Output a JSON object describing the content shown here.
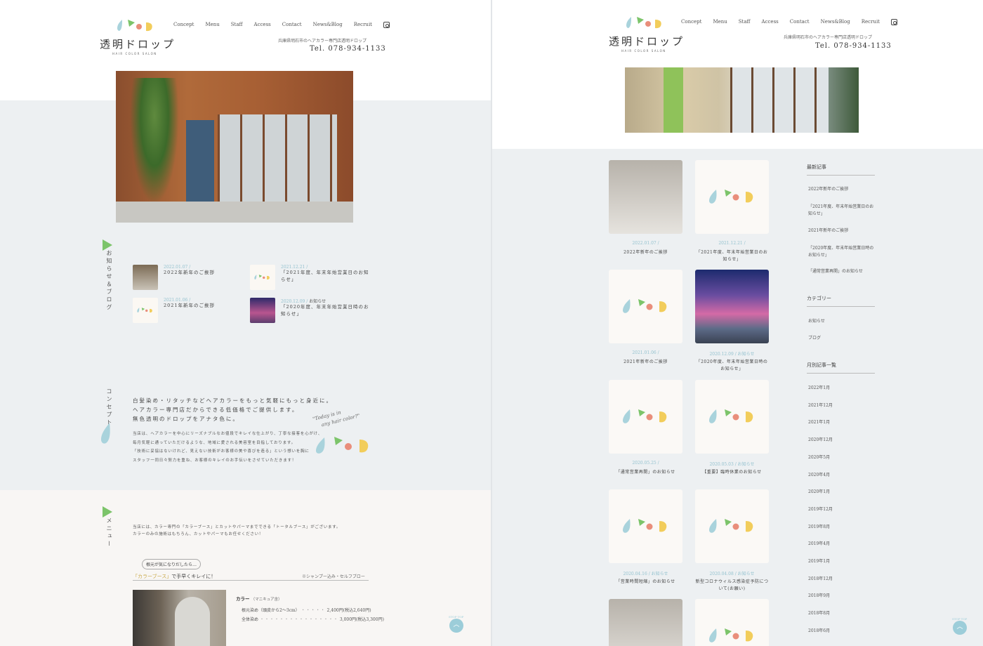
{
  "brand": {
    "name_jp": "透明ドロップ",
    "name_en": "HAIR COLOR SALON",
    "address": "兵庫県明石市のヘアカラー専門店透明ドロップ",
    "tel": "Tel. 078-934-1133"
  },
  "nav": [
    "Concept",
    "Menu",
    "Staff",
    "Access",
    "Contact",
    "News&Blog",
    "Recruit"
  ],
  "colors": {
    "drop_blue": "#a9d3dc",
    "drop_green": "#7cc46a",
    "drop_red": "#e98e7b",
    "drop_yellow": "#f2cd5b",
    "accent": "#94c2cf"
  },
  "left": {
    "news_label": "お知らせ＆ブログ",
    "news": [
      {
        "date": "2022.01.07 /",
        "cat": "",
        "title": "2022年新年のご挨拶",
        "thumb": "wall"
      },
      {
        "date": "2021.12.21 /",
        "cat": "",
        "title": "「2021年度、年末年始営業日のお知らせ」",
        "thumb": "logo"
      },
      {
        "date": "2021.01.06 /",
        "cat": "",
        "title": "2021年新年のご挨拶",
        "thumb": "logo"
      },
      {
        "date": "2020.12.09 /",
        "cat": "お知らせ",
        "title": "「2020年度、年末年始営業日時のお知らせ」",
        "thumb": "sky"
      }
    ],
    "concept_label": "コンセプト",
    "concept_lead": [
      "白髪染め・リタッチなどヘアカラーをもっと気軽にもっと身近に。",
      "ヘアカラー専門店だからできる低価格でご提供します。",
      "無色透明のドロップをアナタ色に。"
    ],
    "concept_body": [
      "当店は、ヘアカラーを中心にリーズナブルなお値段でキレイな仕上がり、丁寧な接客を心がけ、",
      "毎月気軽に通っていただけるような、地域に愛される美容室を目指しております。",
      "「技術に妥協はないけれど、見えない技術がお客様の美や喜びを造る」という想いを胸に",
      "スタッフ一同日々努力を重ね、お客様のキレイのお手伝いをさせていただきます！"
    ],
    "tagline": [
      "\"Today is in",
      "any hair color?\""
    ],
    "menu_label": "メニュー",
    "menu_intro": [
      "当店には、カラー専門の「カラーブース」とカットやパーマまでできる「トータルブース」がございます。",
      "カラーのみの施術はもちろん、カットやパーマもお任せください！"
    ],
    "pill": "根元が気になりだしたら…",
    "colorbooth_em": "「カラーブース」",
    "colorbooth_rest": "で手早くキレイに！",
    "shampoo": "※シャンプー込み・セルフブロー",
    "price_head": "カラー",
    "price_head_note": "（マニキュア含）",
    "prices": [
      {
        "name": "根元染め（頭皮から2〜3cm）",
        "dots": "・・・・・",
        "price": "2,400円(税込2,640円)"
      },
      {
        "name": "全体染め",
        "dots": "・・・・・・・・・・・・・・・・",
        "price": "3,000円(税込3,300円)"
      }
    ],
    "stoptop": "STOP TOP"
  },
  "right": {
    "posts": [
      {
        "date": "2022.01.07 /",
        "cat": "",
        "title": "2022年新年のご挨拶",
        "thumb": "wall"
      },
      {
        "date": "2021.12.21 /",
        "cat": "",
        "title": "「2021年度、年末年始営業日のお知らせ」",
        "thumb": "logo"
      },
      {
        "date": "2021.01.06 /",
        "cat": "",
        "title": "2021年新年のご挨拶",
        "thumb": "logo"
      },
      {
        "date": "2020.12.09 /",
        "cat": "お知らせ",
        "title": "「2020年度、年末年始営業日時のお知らせ」",
        "thumb": "sky"
      },
      {
        "date": "2020.05.25 /",
        "cat": "",
        "title": "「通常営業再開」のお知らせ",
        "thumb": "logo"
      },
      {
        "date": "2020.05.03 /",
        "cat": "お知らせ",
        "title": "【重要】臨時休業のお知らせ",
        "thumb": "logo"
      },
      {
        "date": "2020.04.16 /",
        "cat": "お知らせ",
        "title": "「営業時間短縮」のお知らせ",
        "thumb": "logo"
      },
      {
        "date": "2020.04.08 /",
        "cat": "お知らせ",
        "title": "新型コロナウィルス感染症予防について(お願い)",
        "thumb": "logo"
      },
      {
        "date": "",
        "cat": "",
        "title": "",
        "thumb": "wall"
      },
      {
        "date": "",
        "cat": "",
        "title": "",
        "thumb": "logo"
      }
    ],
    "sidebar": {
      "recent_heading": "最新記事",
      "recent": [
        "2022年新年のご挨拶",
        "「2021年度、年末年始営業日のお知らせ」",
        "2021年新年のご挨拶",
        "「2020年度、年末年始営業日時のお知らせ」",
        "「通常営業再開」のお知らせ"
      ],
      "category_heading": "カテゴリー",
      "categories": [
        "お知らせ",
        "ブログ"
      ],
      "archive_heading": "月別記事一覧",
      "archives": [
        "2022年1月",
        "2021年12月",
        "2021年1月",
        "2020年12月",
        "2020年5月",
        "2020年4月",
        "2020年1月",
        "2019年12月",
        "2019年8月",
        "2019年4月",
        "2019年1月",
        "2018年12月",
        "2018年9月",
        "2018年8月",
        "2018年6月"
      ]
    },
    "stoptop": "STOP TOP"
  }
}
